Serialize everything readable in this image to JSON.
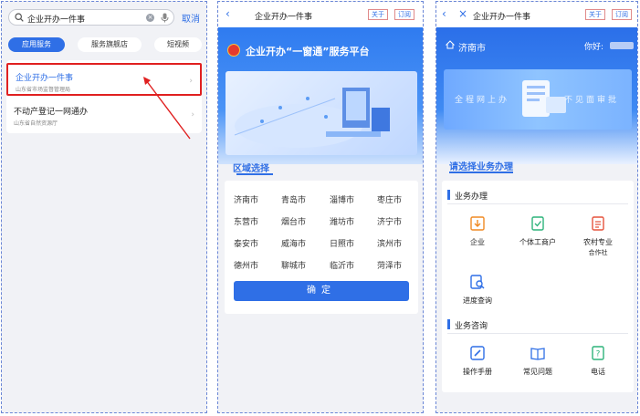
{
  "panel1": {
    "search": {
      "value": "企业开办一件事",
      "clear_icon": "clear-icon",
      "mic_icon": "mic-icon"
    },
    "cancel_label": "取消",
    "tabs": [
      "应用服务",
      "服务旗舰店",
      "短视频"
    ],
    "results": [
      {
        "title": "企业开办一件事",
        "subtitle": "山东省市场监督管理局",
        "highlighted": true
      },
      {
        "title": "不动产登记一网通办",
        "subtitle": "山东省自然资源厅",
        "highlighted": false
      }
    ],
    "annotation_color": "#e02020"
  },
  "panel2": {
    "nav_title": "企业开办一件事",
    "btn_about": "关于",
    "btn_subscribe": "订阅",
    "banner_title": "企业开办“一窗通”服务平台",
    "region_label": "区域选择",
    "cities": [
      [
        "济南市",
        "青岛市",
        "淄博市",
        "枣庄市"
      ],
      [
        "东营市",
        "烟台市",
        "潍坊市",
        "济宁市"
      ],
      [
        "泰安市",
        "威海市",
        "日照市",
        "滨州市"
      ],
      [
        "德州市",
        "聊城市",
        "临沂市",
        "菏泽市"
      ]
    ],
    "confirm_label": "确定"
  },
  "panel3": {
    "nav_title": "企业开办一件事",
    "btn_about": "关于",
    "btn_subscribe": "订阅",
    "city": "济南市",
    "greeting": "你好:",
    "slogan_left": "全程网上办",
    "slogan_right": "不见面审批",
    "select_label": "请选择业务办理",
    "section1_title": "业务办理",
    "services": [
      {
        "label": "企业",
        "icon": "enterprise-icon"
      },
      {
        "label": "个体工商户",
        "icon": "individual-business-icon"
      },
      {
        "label": "农村专业",
        "label2": "合作社",
        "icon": "cooperative-icon"
      },
      {
        "label": "进度查询",
        "icon": "progress-query-icon"
      }
    ],
    "section2_title": "业务咨询",
    "consult": [
      {
        "label": "操作手册",
        "icon": "manual-icon"
      },
      {
        "label": "常见问题",
        "icon": "faq-icon"
      },
      {
        "label": "电话",
        "icon": "phone-icon"
      }
    ],
    "accent_color": "#2f6fe6"
  }
}
